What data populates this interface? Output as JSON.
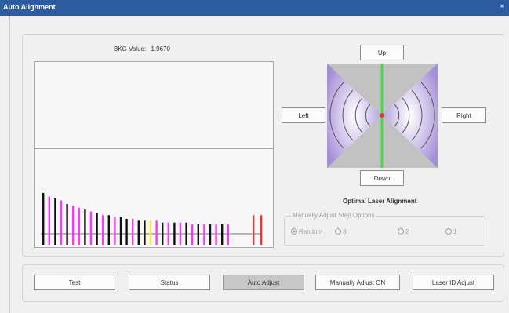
{
  "window": {
    "title": "Auto Alignment",
    "close_glyph": "×"
  },
  "bkg": {
    "label": "BKG Value:",
    "value": "1.9670"
  },
  "directions": {
    "up": "Up",
    "down": "Down",
    "left": "Left",
    "right": "Right"
  },
  "alignment": {
    "caption": "Optimal Laser Alignment"
  },
  "step_options": {
    "legend": "Manually Adjust Step Options",
    "options": [
      "Random",
      "3",
      "2",
      "1"
    ],
    "selected": "Random"
  },
  "buttons": {
    "test": "Test",
    "status": "Status",
    "auto_adjust": "Auto Adjust",
    "manual_adjust": "Manually Adjust ON",
    "laser_id": "Laser ID Adjust"
  },
  "colors": {
    "accent": "#2c5b9f",
    "purple": "#b19be0",
    "green": "#4cd64c",
    "magenta": "#ff33ff",
    "red": "#e23a3a",
    "yellow": "#f3ea3a"
  },
  "bars": [
    {
      "color": "#111",
      "level": 0.28
    },
    {
      "color": "#ff33ff",
      "level": 0.26
    },
    {
      "color": "#111",
      "level": 0.25
    },
    {
      "color": "#ff33ff",
      "level": 0.24
    },
    {
      "color": "#111",
      "level": 0.22
    },
    {
      "color": "#ff33ff",
      "level": 0.21
    },
    {
      "color": "#ff33ff",
      "level": 0.2
    },
    {
      "color": "#111",
      "level": 0.19
    },
    {
      "color": "#ff33ff",
      "level": 0.18
    },
    {
      "color": "#111",
      "level": 0.17
    },
    {
      "color": "#ff33ff",
      "level": 0.16
    },
    {
      "color": "#111",
      "level": 0.16
    },
    {
      "color": "#ff33ff",
      "level": 0.15
    },
    {
      "color": "#111",
      "level": 0.15
    },
    {
      "color": "#111",
      "level": 0.14
    },
    {
      "color": "#ff33ff",
      "level": 0.14
    },
    {
      "color": "#111",
      "level": 0.13
    },
    {
      "color": "#111",
      "level": 0.13
    },
    {
      "color": "#f3ea3a",
      "level": 0.13
    },
    {
      "color": "#ff33ff",
      "level": 0.13
    },
    {
      "color": "#111",
      "level": 0.12
    },
    {
      "color": "#ff33ff",
      "level": 0.12
    },
    {
      "color": "#111",
      "level": 0.12
    },
    {
      "color": "#ff33ff",
      "level": 0.12
    },
    {
      "color": "#111",
      "level": 0.12
    },
    {
      "color": "#ff33ff",
      "level": 0.11
    },
    {
      "color": "#111",
      "level": 0.11
    },
    {
      "color": "#ff33ff",
      "level": 0.11
    },
    {
      "color": "#111",
      "level": 0.11
    },
    {
      "color": "#ff33ff",
      "level": 0.11
    },
    {
      "color": "#111",
      "level": 0.11
    },
    {
      "color": "#ff33ff",
      "level": 0.11
    },
    {
      "color": "#e23a3a",
      "level": 0.16
    },
    {
      "color": "#e23a3a",
      "level": 0.16
    }
  ]
}
